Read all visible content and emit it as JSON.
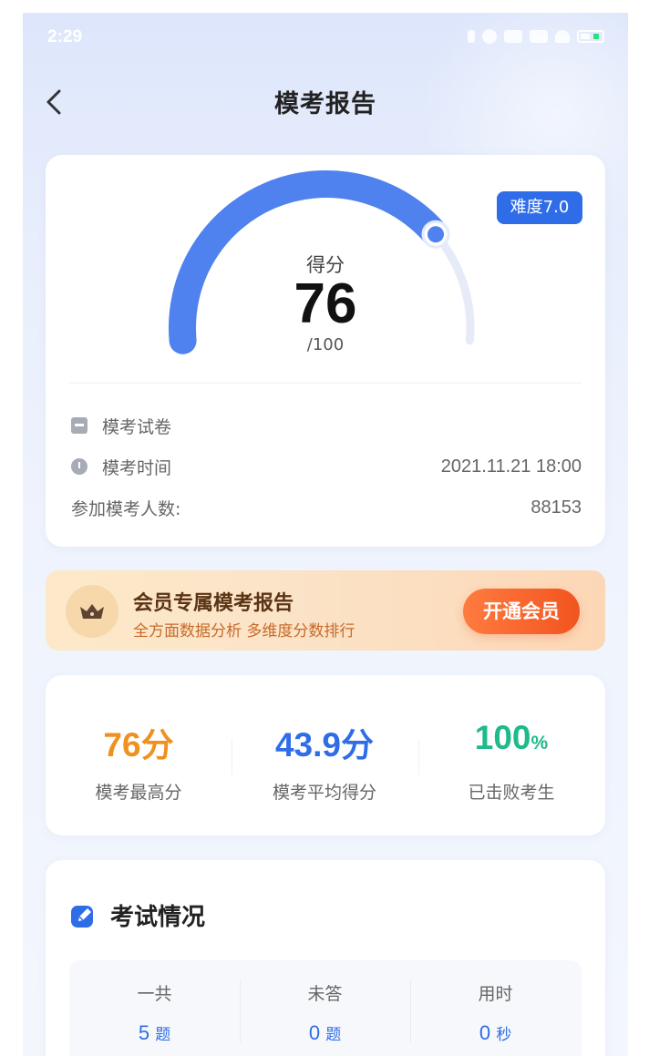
{
  "status_bar": {
    "time": "2:29"
  },
  "header": {
    "title": "模考报告"
  },
  "score_card": {
    "difficulty": "难度7.0",
    "score_label": "得分",
    "score": "76",
    "total": "/100",
    "score_fraction": 0.76,
    "rows": [
      {
        "label": "模考试卷",
        "value": ""
      },
      {
        "label": "模考时间",
        "value": "2021.11.21 18:00"
      },
      {
        "label": "参加模考人数:",
        "value": "88153"
      }
    ]
  },
  "vip_banner": {
    "title": "会员专属模考报告",
    "subtitle": "全方面数据分析 多维度分数排行",
    "button": "开通会员"
  },
  "stats": [
    {
      "value": "76",
      "unit": "分",
      "label": "模考最高分",
      "color": "#f0901e"
    },
    {
      "value": "43.9",
      "unit": "分",
      "label": "模考平均得分",
      "color": "#2f6de8"
    },
    {
      "value": "100",
      "unit": "%",
      "label": "已击败考生",
      "color": "#1fba8c"
    }
  ],
  "exam": {
    "title": "考试情况",
    "columns": [
      {
        "label": "一共",
        "value": "5",
        "unit": "题"
      },
      {
        "label": "未答",
        "value": "0",
        "unit": "题"
      },
      {
        "label": "用时",
        "value": "0",
        "unit": "秒"
      }
    ]
  },
  "colors": {
    "accent": "#2f6de8",
    "vip_button": "#f2541f",
    "gauge_track": "#e7ebf7"
  }
}
